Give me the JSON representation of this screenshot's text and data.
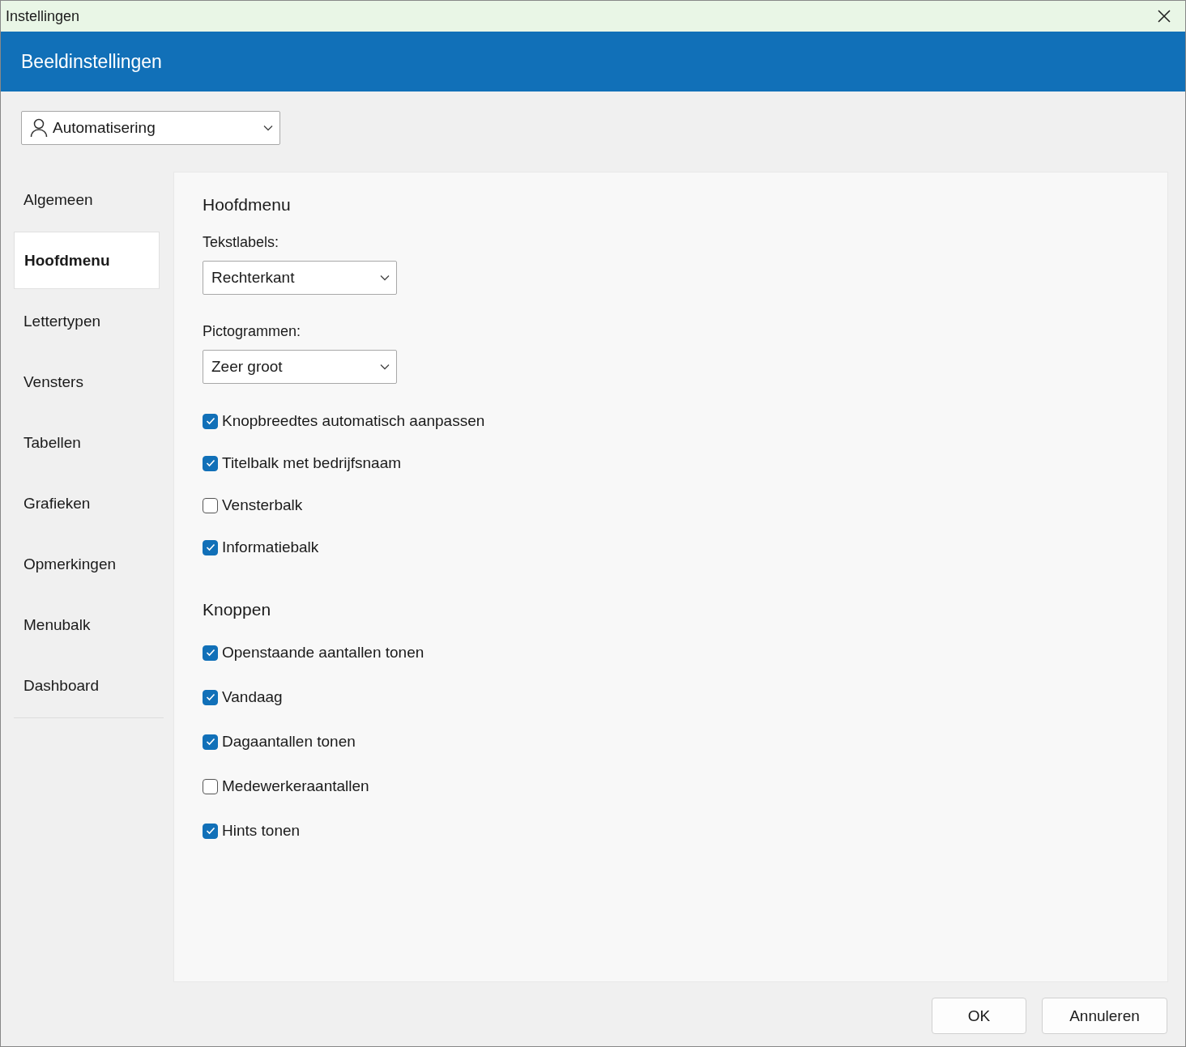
{
  "window": {
    "title": "Instellingen"
  },
  "header": {
    "title": "Beeldinstellingen"
  },
  "profile_select": {
    "value": "Automatisering"
  },
  "sidebar": {
    "items": [
      {
        "label": "Algemeen",
        "selected": false
      },
      {
        "label": "Hoofdmenu",
        "selected": true
      },
      {
        "label": "Lettertypen",
        "selected": false
      },
      {
        "label": "Vensters",
        "selected": false
      },
      {
        "label": "Tabellen",
        "selected": false
      },
      {
        "label": "Grafieken",
        "selected": false
      },
      {
        "label": "Opmerkingen",
        "selected": false
      },
      {
        "label": "Menubalk",
        "selected": false
      },
      {
        "label": "Dashboard",
        "selected": false
      }
    ]
  },
  "content": {
    "sections": [
      {
        "title": "Hoofdmenu",
        "fields": [
          {
            "label": "Tekstlabels:",
            "value": "Rechterkant"
          },
          {
            "label": "Pictogrammen:",
            "value": "Zeer groot"
          }
        ],
        "options": [
          {
            "label": "Knopbreedtes automatisch aanpassen",
            "checked": true
          },
          {
            "label": "Titelbalk met bedrijfsnaam",
            "checked": true
          },
          {
            "label": "Vensterbalk",
            "checked": false
          },
          {
            "label": "Informatiebalk",
            "checked": true
          }
        ]
      },
      {
        "title": "Knoppen",
        "options": [
          {
            "label": "Openstaande aantallen tonen",
            "checked": true
          },
          {
            "label": "Vandaag",
            "checked": true
          },
          {
            "label": "Dagaantallen tonen",
            "checked": true
          },
          {
            "label": "Medewerkeraantallen",
            "checked": false
          },
          {
            "label": "Hints tonen",
            "checked": true
          }
        ]
      }
    ]
  },
  "buttons": [
    "OK",
    "Annuleren"
  ]
}
